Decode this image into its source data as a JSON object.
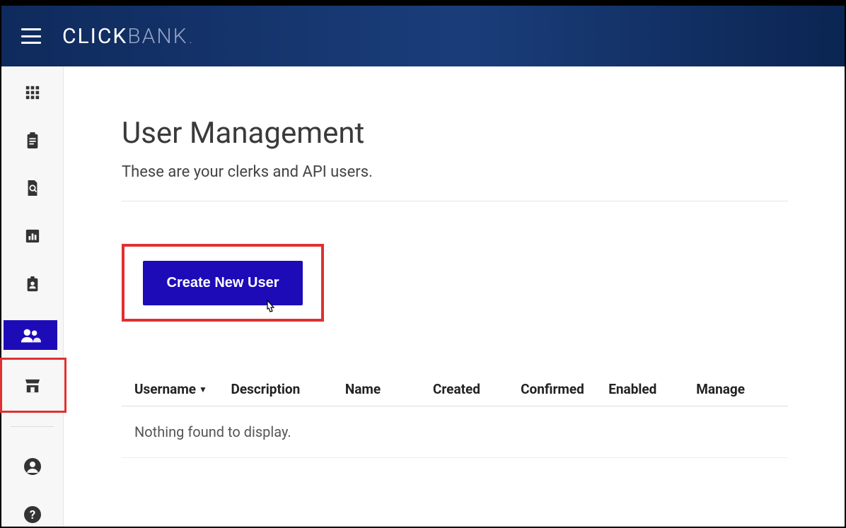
{
  "header": {
    "logo_prefix": "CLICK",
    "logo_suffix": "BANK"
  },
  "sidebar": {
    "items": [
      {
        "icon": "apps-icon"
      },
      {
        "icon": "clipboard-icon"
      },
      {
        "icon": "search-doc-icon"
      },
      {
        "icon": "chart-icon"
      },
      {
        "icon": "badge-icon"
      },
      {
        "icon": "users-icon",
        "active": true
      },
      {
        "icon": "storefront-icon"
      }
    ],
    "bottom": [
      {
        "icon": "account-icon"
      },
      {
        "icon": "help-icon"
      }
    ]
  },
  "page": {
    "title": "User Management",
    "subtitle": "These are your clerks and API users.",
    "create_button": "Create New User"
  },
  "table": {
    "columns": {
      "username": "Username",
      "description": "Description",
      "name": "Name",
      "created": "Created",
      "confirmed": "Confirmed",
      "enabled": "Enabled",
      "manage": "Manage"
    },
    "empty_message": "Nothing found to display."
  }
}
